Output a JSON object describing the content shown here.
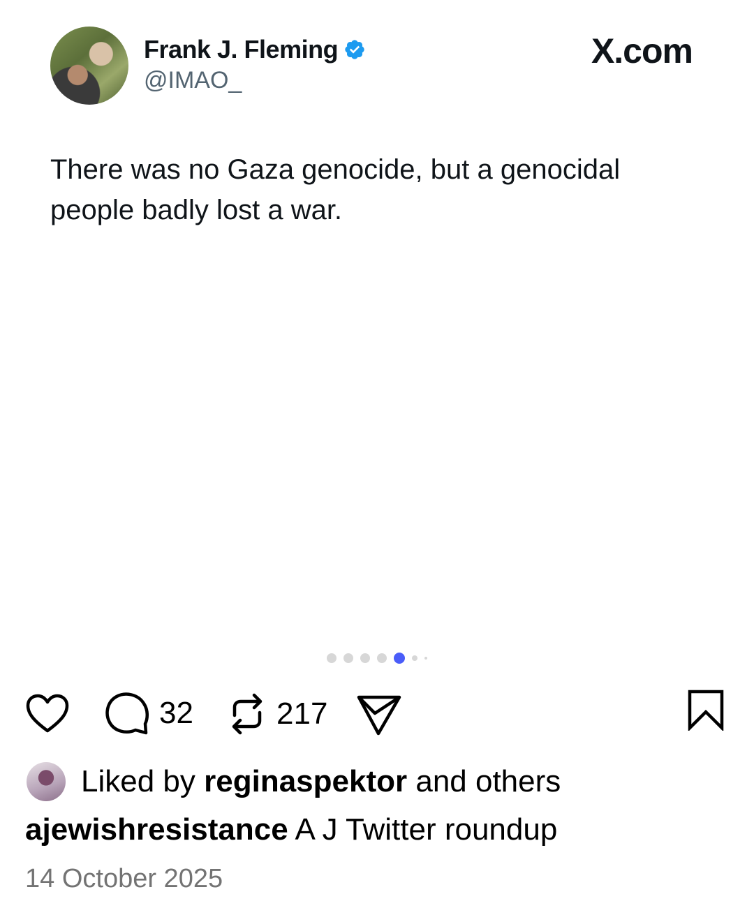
{
  "tweet": {
    "author_name": "Frank J. Fleming",
    "author_handle": "@IMAO_",
    "brand": "X.com",
    "text": "There was no Gaza genocide, but a genocidal people badly lost a war.",
    "verified_color": "#1d9bf0"
  },
  "carousel": {
    "dot_count": 7,
    "active_index": 4,
    "active_color": "#4a5df9"
  },
  "actions": {
    "like_icon": "heart-icon",
    "comment_icon": "comment-icon",
    "comment_count": "32",
    "repost_icon": "repost-icon",
    "repost_count": "217",
    "share_icon": "send-icon",
    "save_icon": "bookmark-icon"
  },
  "likes": {
    "prefix": "Liked by",
    "user": "reginaspektor",
    "suffix": "and others"
  },
  "caption": {
    "username": "ajewishresistance",
    "text": "A J Twitter roundup"
  },
  "date": "14 October 2025"
}
